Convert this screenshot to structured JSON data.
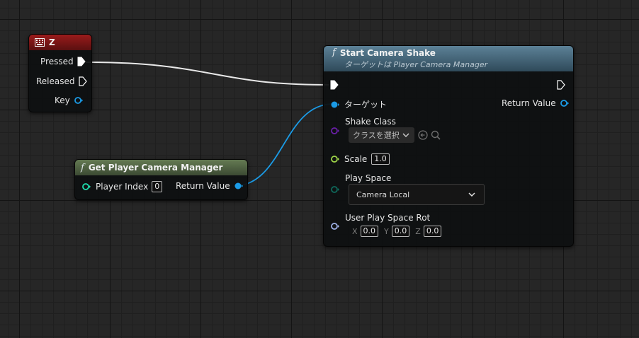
{
  "nodes": {
    "key_event": {
      "title": "Z",
      "pins": {
        "pressed": "Pressed",
        "released": "Released",
        "key": "Key"
      }
    },
    "get_pcm": {
      "title": "Get Player Camera Manager",
      "player_index_label": "Player Index",
      "player_index_value": "0",
      "return_label": "Return Value"
    },
    "camera_shake": {
      "title": "Start Camera Shake",
      "subtitle": "ターゲットは Player Camera Manager",
      "target_label": "ターゲット",
      "return_label": "Return Value",
      "shake_class_label": "Shake Class",
      "shake_class_value": "クラスを選択",
      "scale_label": "Scale",
      "scale_value": "1.0",
      "play_space_label": "Play Space",
      "play_space_value": "Camera Local",
      "rot_label": "User Play Space Rot",
      "rot_x_label": "X",
      "rot_x": "0.0",
      "rot_y_label": "Y",
      "rot_y": "0.0",
      "rot_z_label": "Z",
      "rot_z": "0.0"
    }
  },
  "colors": {
    "exec": "#ffffff",
    "object_pin": "#1b9be6",
    "class_pin": "#6a1fa8",
    "float_pin": "#9ed548",
    "byte_pin": "#0e6a5c",
    "rotator_pin": "#a0b2e8",
    "int_pin": "#1fe0b0"
  }
}
